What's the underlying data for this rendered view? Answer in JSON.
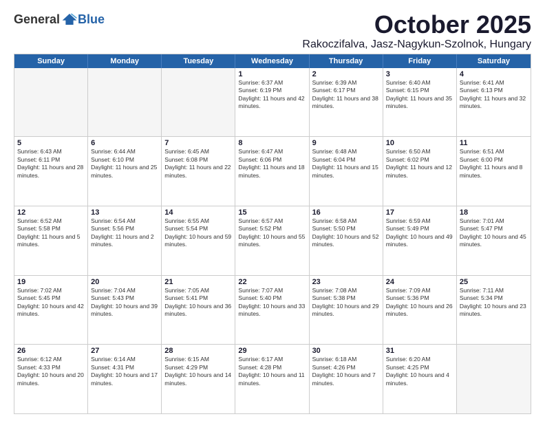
{
  "header": {
    "logo_general": "General",
    "logo_blue": "Blue",
    "month_title": "October 2025",
    "location": "Rakoczifalva, Jasz-Nagykun-Szolnok, Hungary"
  },
  "days_of_week": [
    "Sunday",
    "Monday",
    "Tuesday",
    "Wednesday",
    "Thursday",
    "Friday",
    "Saturday"
  ],
  "weeks": [
    [
      {
        "day": "",
        "empty": true
      },
      {
        "day": "",
        "empty": true
      },
      {
        "day": "",
        "empty": true
      },
      {
        "day": "1",
        "sunrise": "Sunrise: 6:37 AM",
        "sunset": "Sunset: 6:19 PM",
        "daylight": "Daylight: 11 hours and 42 minutes."
      },
      {
        "day": "2",
        "sunrise": "Sunrise: 6:39 AM",
        "sunset": "Sunset: 6:17 PM",
        "daylight": "Daylight: 11 hours and 38 minutes."
      },
      {
        "day": "3",
        "sunrise": "Sunrise: 6:40 AM",
        "sunset": "Sunset: 6:15 PM",
        "daylight": "Daylight: 11 hours and 35 minutes."
      },
      {
        "day": "4",
        "sunrise": "Sunrise: 6:41 AM",
        "sunset": "Sunset: 6:13 PM",
        "daylight": "Daylight: 11 hours and 32 minutes."
      }
    ],
    [
      {
        "day": "5",
        "sunrise": "Sunrise: 6:43 AM",
        "sunset": "Sunset: 6:11 PM",
        "daylight": "Daylight: 11 hours and 28 minutes."
      },
      {
        "day": "6",
        "sunrise": "Sunrise: 6:44 AM",
        "sunset": "Sunset: 6:10 PM",
        "daylight": "Daylight: 11 hours and 25 minutes."
      },
      {
        "day": "7",
        "sunrise": "Sunrise: 6:45 AM",
        "sunset": "Sunset: 6:08 PM",
        "daylight": "Daylight: 11 hours and 22 minutes."
      },
      {
        "day": "8",
        "sunrise": "Sunrise: 6:47 AM",
        "sunset": "Sunset: 6:06 PM",
        "daylight": "Daylight: 11 hours and 18 minutes."
      },
      {
        "day": "9",
        "sunrise": "Sunrise: 6:48 AM",
        "sunset": "Sunset: 6:04 PM",
        "daylight": "Daylight: 11 hours and 15 minutes."
      },
      {
        "day": "10",
        "sunrise": "Sunrise: 6:50 AM",
        "sunset": "Sunset: 6:02 PM",
        "daylight": "Daylight: 11 hours and 12 minutes."
      },
      {
        "day": "11",
        "sunrise": "Sunrise: 6:51 AM",
        "sunset": "Sunset: 6:00 PM",
        "daylight": "Daylight: 11 hours and 8 minutes."
      }
    ],
    [
      {
        "day": "12",
        "sunrise": "Sunrise: 6:52 AM",
        "sunset": "Sunset: 5:58 PM",
        "daylight": "Daylight: 11 hours and 5 minutes."
      },
      {
        "day": "13",
        "sunrise": "Sunrise: 6:54 AM",
        "sunset": "Sunset: 5:56 PM",
        "daylight": "Daylight: 11 hours and 2 minutes."
      },
      {
        "day": "14",
        "sunrise": "Sunrise: 6:55 AM",
        "sunset": "Sunset: 5:54 PM",
        "daylight": "Daylight: 10 hours and 59 minutes."
      },
      {
        "day": "15",
        "sunrise": "Sunrise: 6:57 AM",
        "sunset": "Sunset: 5:52 PM",
        "daylight": "Daylight: 10 hours and 55 minutes."
      },
      {
        "day": "16",
        "sunrise": "Sunrise: 6:58 AM",
        "sunset": "Sunset: 5:50 PM",
        "daylight": "Daylight: 10 hours and 52 minutes."
      },
      {
        "day": "17",
        "sunrise": "Sunrise: 6:59 AM",
        "sunset": "Sunset: 5:49 PM",
        "daylight": "Daylight: 10 hours and 49 minutes."
      },
      {
        "day": "18",
        "sunrise": "Sunrise: 7:01 AM",
        "sunset": "Sunset: 5:47 PM",
        "daylight": "Daylight: 10 hours and 45 minutes."
      }
    ],
    [
      {
        "day": "19",
        "sunrise": "Sunrise: 7:02 AM",
        "sunset": "Sunset: 5:45 PM",
        "daylight": "Daylight: 10 hours and 42 minutes."
      },
      {
        "day": "20",
        "sunrise": "Sunrise: 7:04 AM",
        "sunset": "Sunset: 5:43 PM",
        "daylight": "Daylight: 10 hours and 39 minutes."
      },
      {
        "day": "21",
        "sunrise": "Sunrise: 7:05 AM",
        "sunset": "Sunset: 5:41 PM",
        "daylight": "Daylight: 10 hours and 36 minutes."
      },
      {
        "day": "22",
        "sunrise": "Sunrise: 7:07 AM",
        "sunset": "Sunset: 5:40 PM",
        "daylight": "Daylight: 10 hours and 33 minutes."
      },
      {
        "day": "23",
        "sunrise": "Sunrise: 7:08 AM",
        "sunset": "Sunset: 5:38 PM",
        "daylight": "Daylight: 10 hours and 29 minutes."
      },
      {
        "day": "24",
        "sunrise": "Sunrise: 7:09 AM",
        "sunset": "Sunset: 5:36 PM",
        "daylight": "Daylight: 10 hours and 26 minutes."
      },
      {
        "day": "25",
        "sunrise": "Sunrise: 7:11 AM",
        "sunset": "Sunset: 5:34 PM",
        "daylight": "Daylight: 10 hours and 23 minutes."
      }
    ],
    [
      {
        "day": "26",
        "sunrise": "Sunrise: 6:12 AM",
        "sunset": "Sunset: 4:33 PM",
        "daylight": "Daylight: 10 hours and 20 minutes."
      },
      {
        "day": "27",
        "sunrise": "Sunrise: 6:14 AM",
        "sunset": "Sunset: 4:31 PM",
        "daylight": "Daylight: 10 hours and 17 minutes."
      },
      {
        "day": "28",
        "sunrise": "Sunrise: 6:15 AM",
        "sunset": "Sunset: 4:29 PM",
        "daylight": "Daylight: 10 hours and 14 minutes."
      },
      {
        "day": "29",
        "sunrise": "Sunrise: 6:17 AM",
        "sunset": "Sunset: 4:28 PM",
        "daylight": "Daylight: 10 hours and 11 minutes."
      },
      {
        "day": "30",
        "sunrise": "Sunrise: 6:18 AM",
        "sunset": "Sunset: 4:26 PM",
        "daylight": "Daylight: 10 hours and 7 minutes."
      },
      {
        "day": "31",
        "sunrise": "Sunrise: 6:20 AM",
        "sunset": "Sunset: 4:25 PM",
        "daylight": "Daylight: 10 hours and 4 minutes."
      },
      {
        "day": "",
        "empty": true
      }
    ]
  ]
}
